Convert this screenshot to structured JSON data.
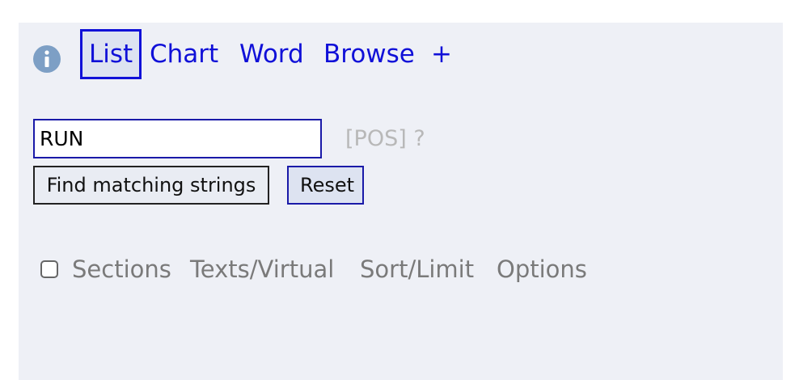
{
  "tabs": {
    "list": "List",
    "chart": "Chart",
    "word": "Word",
    "browse": "Browse",
    "add": "+"
  },
  "search": {
    "value": "RUN",
    "pos_hint": "[POS] ?"
  },
  "buttons": {
    "find": "Find matching strings",
    "reset": "Reset"
  },
  "options": {
    "sections": "Sections",
    "texts_virtual": "Texts/Virtual",
    "sort_limit": "Sort/Limit",
    "options": "Options",
    "sections_checked": false
  },
  "colors": {
    "accent": "#1010d8",
    "panel_bg": "#eef0f6",
    "info_icon": "#7d9fc5",
    "muted_text": "#7a7a7a"
  }
}
